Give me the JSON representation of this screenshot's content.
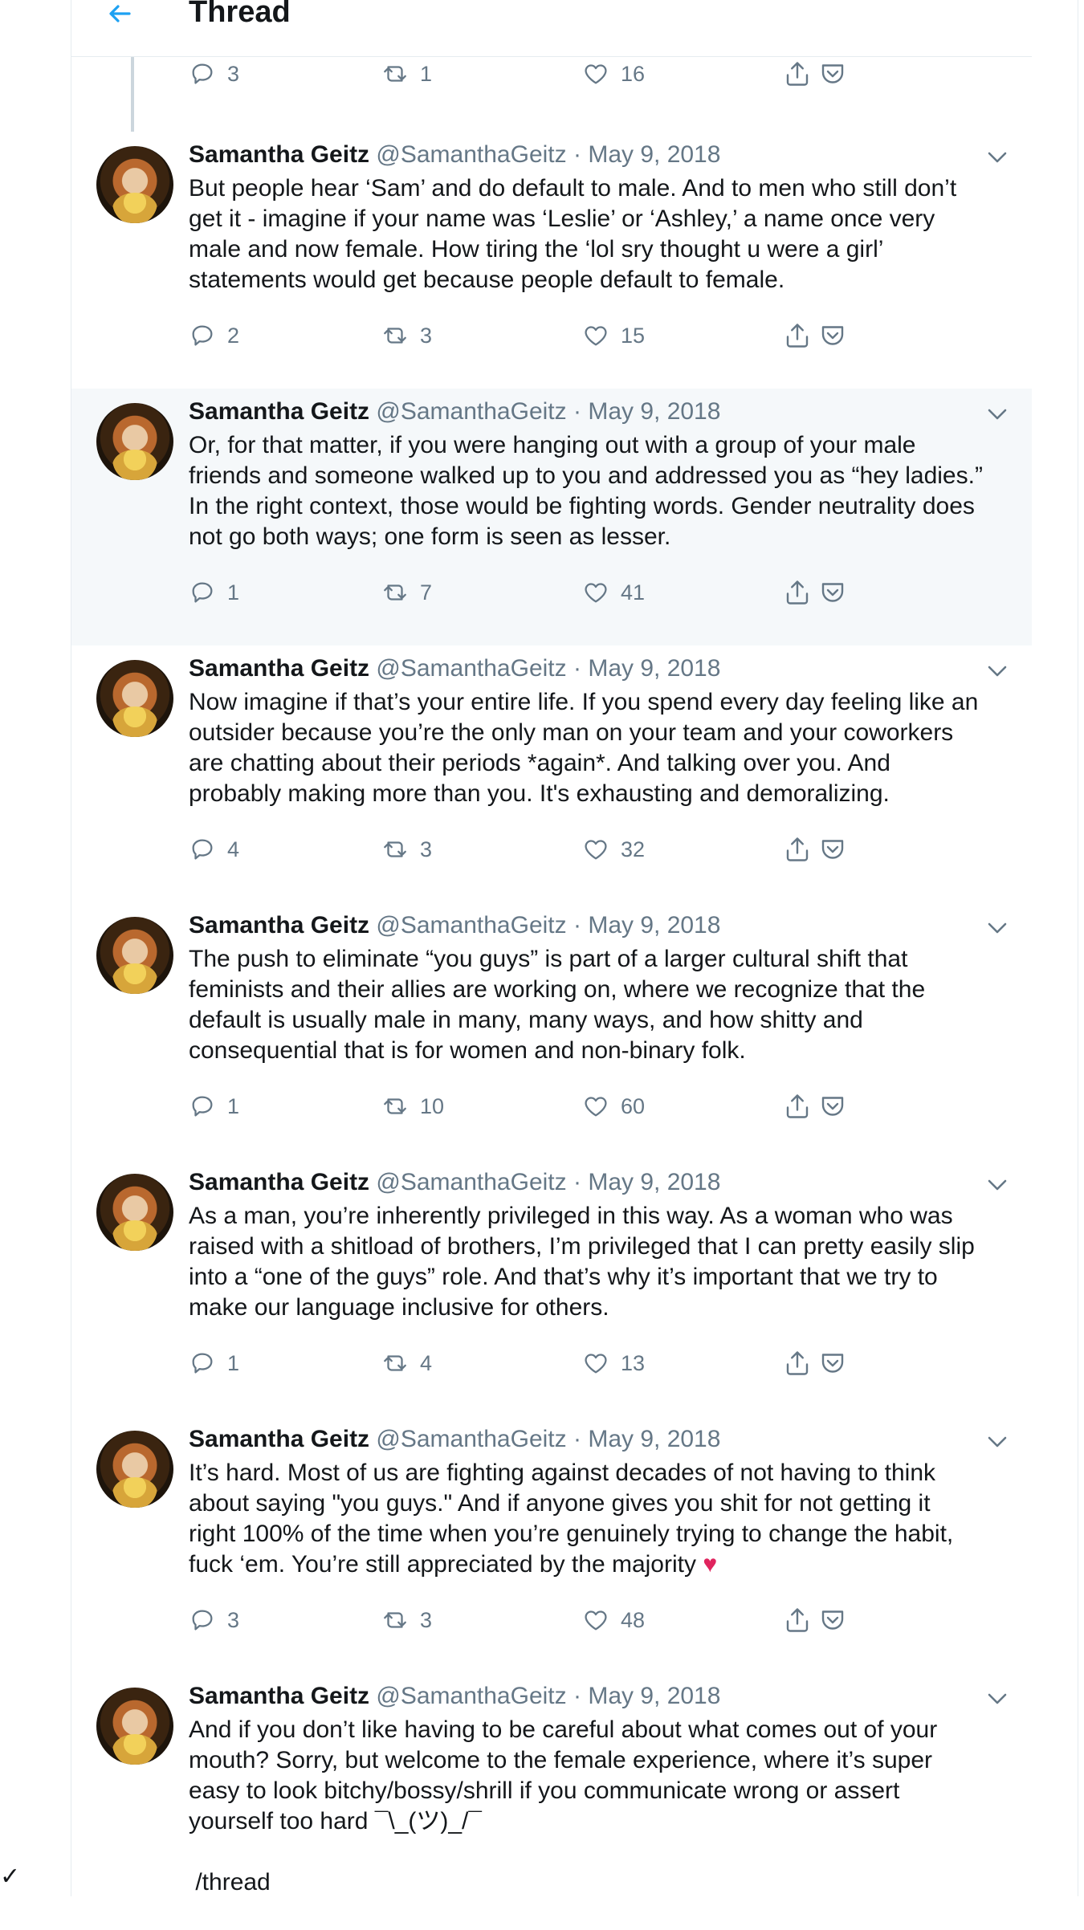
{
  "header": {
    "title": "Thread",
    "back_icon": "arrow-left-icon"
  },
  "colors": {
    "accent": "#1da1f2",
    "muted": "#657786",
    "highlight_bg": "#f5f8fa",
    "thread_line": "#ccd6dd"
  },
  "top_actions": {
    "replies": "3",
    "retweets": "1",
    "likes": "16"
  },
  "tweets": [
    {
      "name": "Samantha Geitz",
      "handle": "@SamanthaGeitz",
      "sep": "·",
      "date": "May 9, 2018",
      "text": "But people hear ‘Sam’ and do default to male. And to men who still don’t\nget it - imagine if your name was ‘Leslie’ or ‘Ashley,’ a name once very\nmale and now female. How tiring the ‘lol sry thought u were a girl’\nstatements would get because people default to female.",
      "replies": "2",
      "retweets": "3",
      "likes": "15"
    },
    {
      "name": "Samantha Geitz",
      "handle": "@SamanthaGeitz",
      "sep": "·",
      "date": "May 9, 2018",
      "text": "Or, for that matter, if you were hanging out with a group of your male\nfriends and someone walked up to you and addressed you as “hey ladies.”\nIn the right context, those would be fighting words. Gender neutrality does\nnot go both ways; one form is seen as lesser.",
      "replies": "1",
      "retweets": "7",
      "likes": "41"
    },
    {
      "name": "Samantha Geitz",
      "handle": "@SamanthaGeitz",
      "sep": "·",
      "date": "May 9, 2018",
      "text": "Now imagine if that’s your entire life. If you spend every day feeling like an\noutsider because you’re the only man on your team and your coworkers\nare chatting about their periods *again*. And talking over you. And\nprobably making more than you. It's exhausting and demoralizing.",
      "replies": "4",
      "retweets": "3",
      "likes": "32"
    },
    {
      "name": "Samantha Geitz",
      "handle": "@SamanthaGeitz",
      "sep": "·",
      "date": "May 9, 2018",
      "text": "The push to eliminate “you guys” is part of a larger cultural shift that\nfeminists and their allies are working on, where we recognize that the\ndefault is usually male in many, many ways, and how shitty and\nconsequential that is for women and non-binary folk.",
      "replies": "1",
      "retweets": "10",
      "likes": "60"
    },
    {
      "name": "Samantha Geitz",
      "handle": "@SamanthaGeitz",
      "sep": "·",
      "date": "May 9, 2018",
      "text": "As a man, you’re inherently privileged in this way. As a woman who was\nraised with a shitload of brothers, I’m privileged that I can pretty easily slip\ninto a “one of the guys” role. And that’s why it’s important that we try to\nmake our language inclusive for others.",
      "replies": "1",
      "retweets": "4",
      "likes": "13"
    },
    {
      "name": "Samantha Geitz",
      "handle": "@SamanthaGeitz",
      "sep": "·",
      "date": "May 9, 2018",
      "text": "It’s hard. Most of us are fighting against decades of not having to think\nabout saying \"you guys.\" And if anyone gives you shit for not getting it\nright 100% of the time when you’re genuinely trying to change the habit,\nfuck ‘em. You’re still appreciated by the majority ",
      "emoji": "♥",
      "replies": "3",
      "retweets": "3",
      "likes": "48"
    },
    {
      "name": "Samantha Geitz",
      "handle": "@SamanthaGeitz",
      "sep": "·",
      "date": "May 9, 2018",
      "text": "And if you don’t like having to be careful about what comes out of your\nmouth? Sorry, but welcome to the female experience, where it’s super\neasy to look bitchy/bossy/shrill if you communicate wrong or assert\nyourself too hard ¯\\_(ツ)_/¯\n\n /thread",
      "replies": "",
      "retweets": "",
      "likes": ""
    }
  ]
}
